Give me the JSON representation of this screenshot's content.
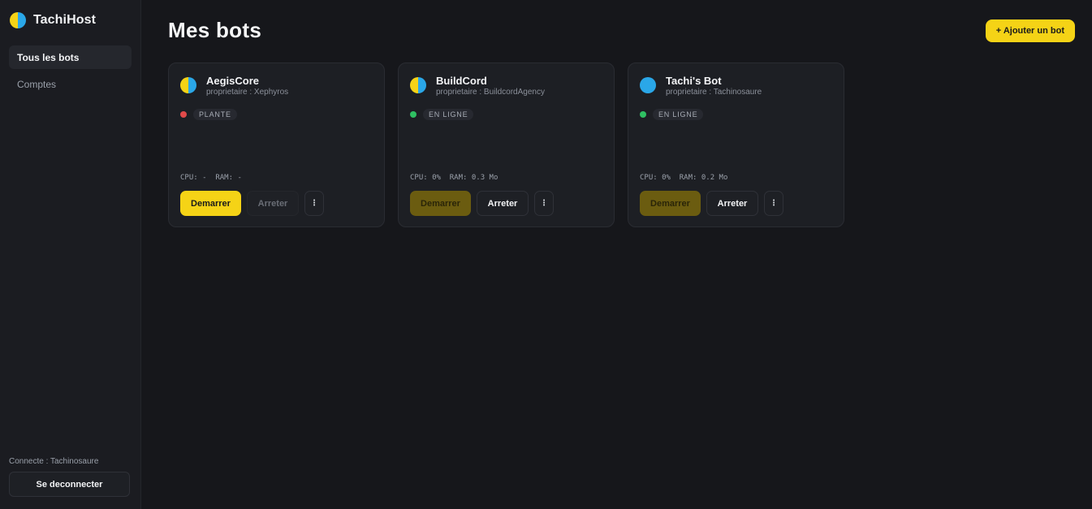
{
  "brand": {
    "name": "TachiHost"
  },
  "nav": {
    "items": [
      {
        "label": "Tous les bots",
        "active": true
      },
      {
        "label": "Comptes",
        "active": false
      }
    ]
  },
  "footer": {
    "connected": "Connecte : Tachinosaure",
    "logout_label": "Se deconnecter"
  },
  "header": {
    "title": "Mes bots",
    "add_label": "+ Ajouter un bot"
  },
  "bots": [
    {
      "name": "AegisCore",
      "owner": "proprietaire : Xephyros",
      "status": "PLANTE",
      "status_color": "#e04a4a",
      "metrics": "CPU: -  RAM: -",
      "start_label": "Demarrer",
      "stop_label": "Arreter",
      "more_label": "⋮",
      "avatar": "split-yellow-blue"
    },
    {
      "name": "BuildCord",
      "owner": "proprietaire : BuildcordAgency",
      "status": "EN LIGNE",
      "status_color": "#2fbf62",
      "metrics": "CPU: 0%  RAM: 0.3 Mo",
      "start_label": "Demarrer",
      "stop_label": "Arreter",
      "more_label": "⋮",
      "avatar": "split-yellow-blue"
    },
    {
      "name": "Tachi's Bot",
      "owner": "proprietaire : Tachinosaure",
      "status": "EN LIGNE",
      "status_color": "#2fbf62",
      "metrics": "CPU: 0%  RAM: 0.2 Mo",
      "start_label": "Demarrer",
      "stop_label": "Arreter",
      "more_label": "⋮",
      "avatar": "blue"
    }
  ],
  "colors": {
    "accent": "#f5d316",
    "background": "#16171b",
    "sidebar": "#1b1c21",
    "card": "#1d1f24"
  }
}
